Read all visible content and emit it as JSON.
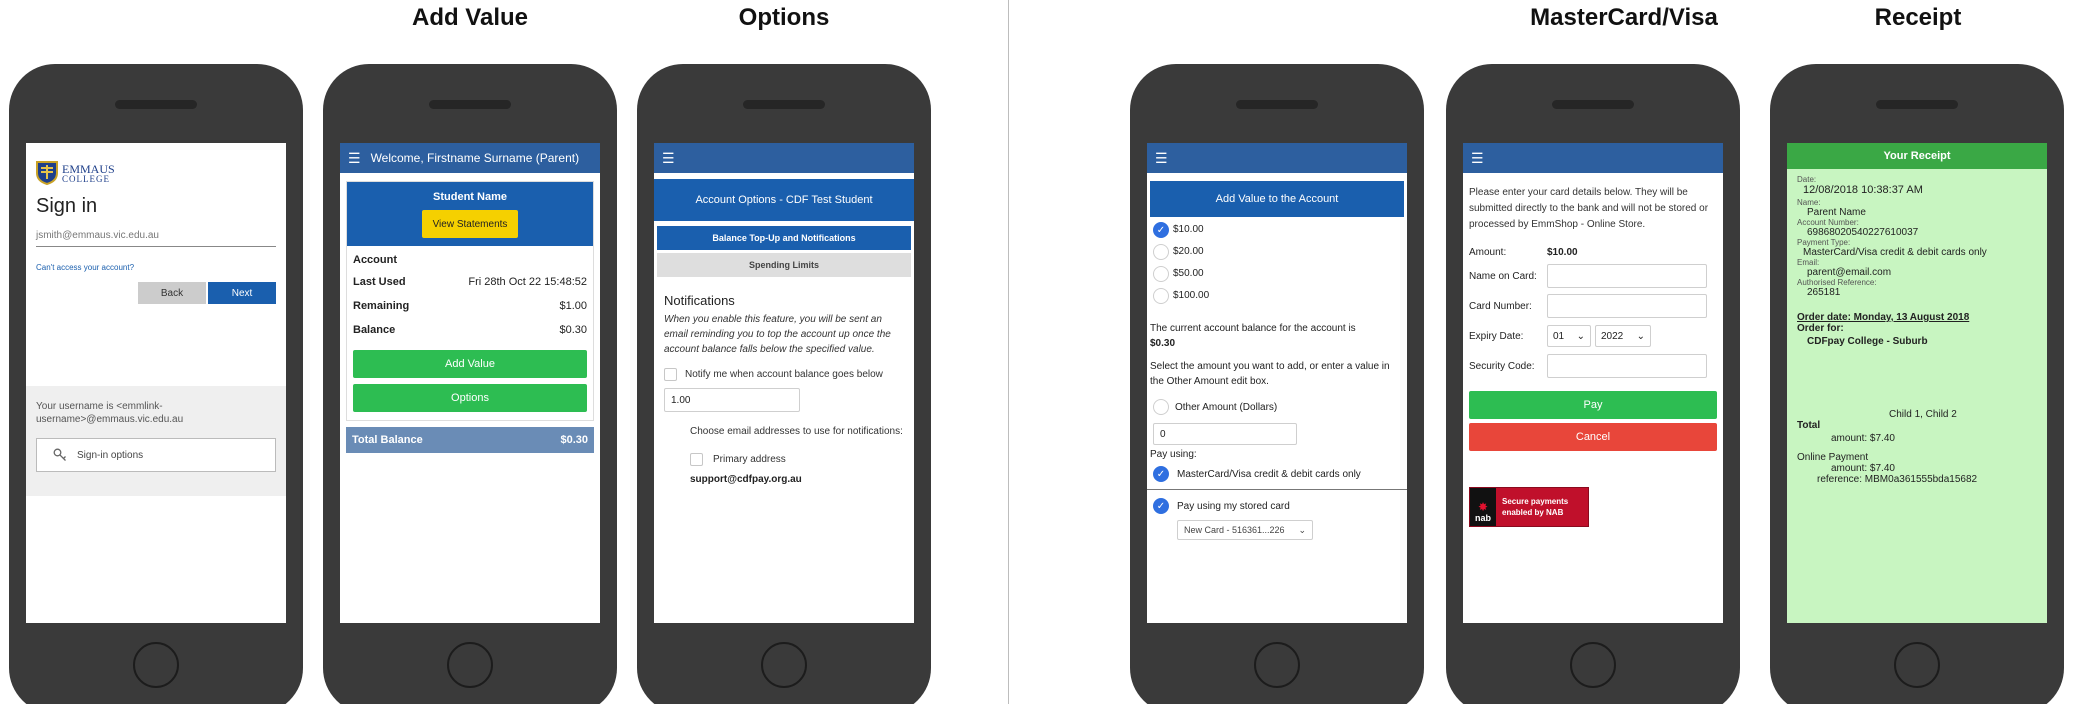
{
  "headings": {
    "add_value": "Add Value",
    "options": "Options",
    "mastercard_visa": "MasterCard/Visa",
    "receipt": "Receipt"
  },
  "signin": {
    "logo_top": "EMMAUS",
    "logo_bottom": "COLLEGE",
    "title": "Sign in",
    "username": "jsmith@emmaus.vic.edu.au",
    "cant_access": "Can't access your account?",
    "back": "Back",
    "next": "Next",
    "info": "Your username is <emmlink-username>@emmaus.vic.edu.au",
    "signin_options": "Sign-in options"
  },
  "account": {
    "welcome": "Welcome, Firstname Surname (Parent)",
    "student_name": "Student Name",
    "view_statements": "View Statements",
    "account_label": "Account",
    "last_used_label": "Last Used",
    "last_used_value": "Fri 28th Oct 22 15:48:52",
    "remaining_label": "Remaining",
    "remaining_value": "$1.00",
    "balance_label": "Balance",
    "balance_value": "$0.30",
    "add_value_button": "Add Value",
    "options_button": "Options",
    "total_balance_label": "Total Balance",
    "total_balance_value": "$0.30"
  },
  "options_screen": {
    "header": "Account Options - CDF Test Student",
    "tab_topup": "Balance Top-Up and Notifications",
    "tab_spending": "Spending Limits",
    "notifications_title": "Notifications",
    "notifications_desc": "When you enable this feature, you will be sent an email reminding you to top the account up once the account balance falls below the specified value.",
    "notify_label": "Notify me when account balance goes below",
    "threshold_value": "1.00",
    "choose_email_label": "Choose email addresses to use for notifications:",
    "primary_address_label": "Primary address",
    "support_email": "support@cdfpay.org.au"
  },
  "add_value_screen": {
    "header": "Add Value to the Account",
    "amounts": [
      "$10.00",
      "$20.00",
      "$50.00",
      "$100.00"
    ],
    "balance_text": "The current account balance for the account is",
    "balance_value": "$0.30",
    "instruction": "Select the amount you want to add, or enter a value in the Other Amount edit box.",
    "other_amount_label": "Other Amount (Dollars)",
    "other_amount_value": "0",
    "pay_using_label": "Pay using:",
    "method_label": "MasterCard/Visa credit & debit cards only",
    "stored_card_label": "Pay using my stored card",
    "stored_card_value": "New Card - 516361...226"
  },
  "card_screen": {
    "intro": "Please enter your card details below. They will be submitted directly to the bank and will not be stored or processed by EmmShop - Online Store.",
    "amount_label": "Amount:",
    "amount_value": "$10.00",
    "name_label": "Name on Card:",
    "number_label": "Card Number:",
    "expiry_label": "Expiry Date:",
    "expiry_month": "01",
    "expiry_year": "2022",
    "security_label": "Security Code:",
    "pay_button": "Pay",
    "cancel_button": "Cancel",
    "nab_logo": "nab",
    "nab_line1": "Secure payments",
    "nab_line2": "enabled by NAB"
  },
  "receipt": {
    "title": "Your Receipt",
    "date_label": "Date:",
    "date_value": "12/08/2018 10:38:37 AM",
    "name_label": "Name:",
    "name_value": "Parent Name",
    "account_number_label": "Account Number:",
    "account_number_value": "69868020540227610037",
    "payment_type_label": "Payment Type:",
    "payment_type_value": "MasterCard/Visa credit & debit cards only",
    "email_label": "Email:",
    "email_value": "parent@email.com",
    "auth_ref_label": "Authorised Reference:",
    "auth_ref_value": "265181",
    "order_date": "Order date: Monday, 13 August 2018",
    "order_for_label": "Order for:",
    "order_for_value": "CDFpay College - Suburb",
    "children": "Child 1, Child 2",
    "total_label": "Total",
    "total_amount": "amount: $7.40",
    "online_payment_label": "Online Payment",
    "online_amount": "amount: $7.40",
    "online_reference": "reference: MBM0a361555bda15682"
  },
  "colors": {
    "appbar_blue": "#2d5f9f",
    "button_green": "#2dbd52",
    "button_red": "#e8463a",
    "receipt_green": "#c8f5c1",
    "receipt_header": "#3aa845"
  }
}
